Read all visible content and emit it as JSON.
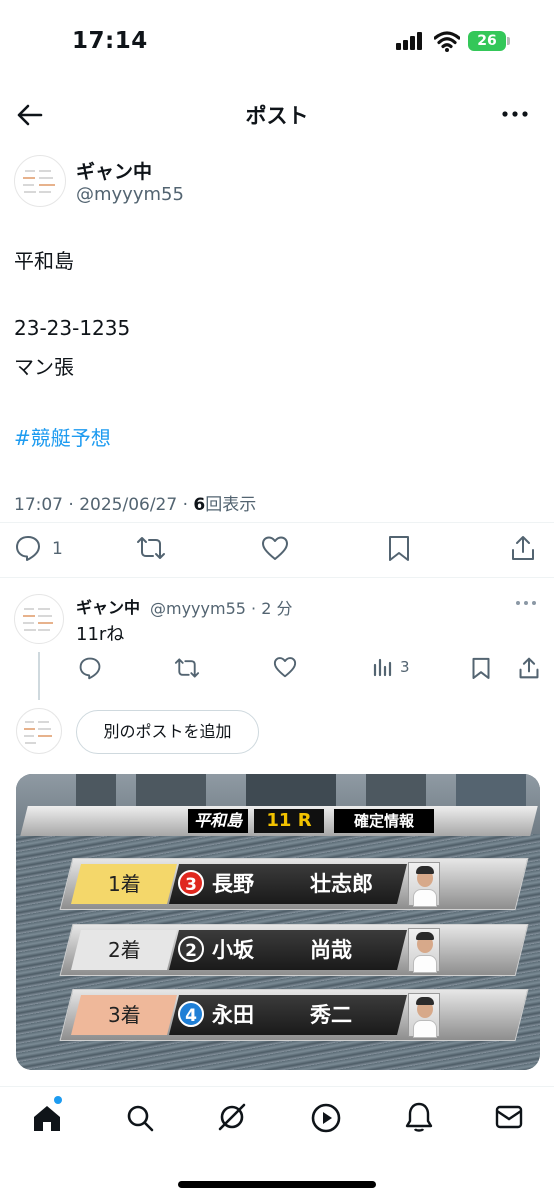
{
  "status": {
    "time": "17:14",
    "battery": "26"
  },
  "header": {
    "title": "ポスト"
  },
  "post": {
    "name": "ギャン中",
    "handle": "@myyym55",
    "lines": [
      "平和島",
      "23-23-1235",
      "マン張"
    ],
    "hashtag": "#競艇予想",
    "time_date": "17:07 · 2025/06/27 · ",
    "views": "6",
    "views_label": "回表示",
    "reply_count": "1"
  },
  "reply": {
    "name": "ギャン中",
    "handle_time": "@myyym55 · 2 分",
    "text": "11rね",
    "views": "3"
  },
  "add_post_label": "別のポストを追加",
  "video": {
    "place": "平和島",
    "race": "11 R",
    "info": "確定情報",
    "results": [
      {
        "pos": "1着",
        "boat": "3",
        "boat_color": "#e0281f",
        "bar_color": "#f4d76a",
        "surname": "長野",
        "given": "壮志郎"
      },
      {
        "pos": "2着",
        "boat": "2",
        "boat_color": "#333333",
        "bar_color": "#e6e6e6",
        "surname": "小坂",
        "given": "尚哉"
      },
      {
        "pos": "3着",
        "boat": "4",
        "boat_color": "#1f7fd6",
        "bar_color": "#efb89a",
        "surname": "永田",
        "given": "秀二"
      }
    ]
  },
  "nav": {
    "items": [
      "home-icon",
      "search-icon",
      "grok-icon",
      "video-icon",
      "notifications-icon",
      "messages-icon"
    ]
  },
  "colors": {
    "accent": "#1d9bf0",
    "secondary_text": "#536471"
  }
}
